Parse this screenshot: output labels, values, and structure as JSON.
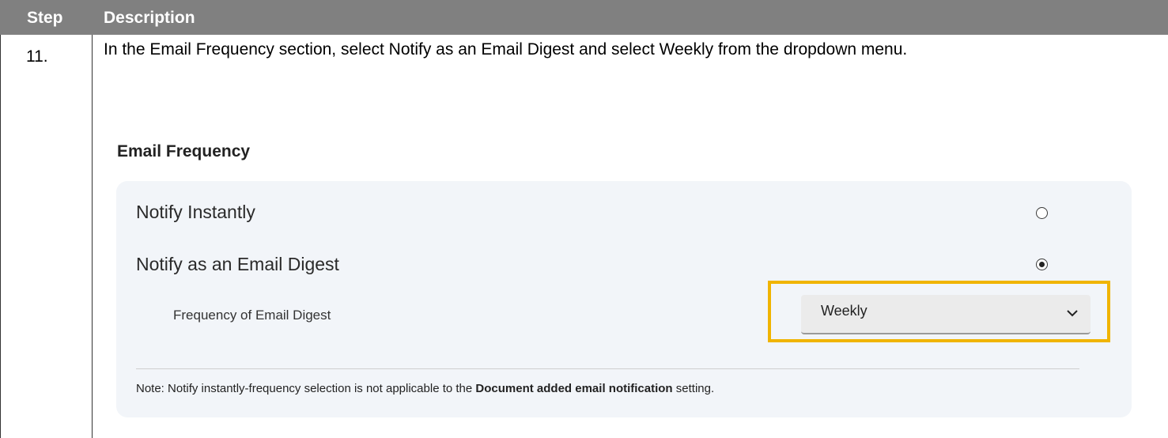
{
  "table": {
    "header_step": "Step",
    "header_description": "Description"
  },
  "step": {
    "number": "11.",
    "instruction": "In the Email Frequency section, select Notify as an Email Digest and select Weekly from the dropdown menu."
  },
  "email_frequency": {
    "title": "Email Frequency",
    "options": [
      {
        "label": "Notify Instantly",
        "selected": false
      },
      {
        "label": "Notify as an Email Digest",
        "selected": true
      }
    ],
    "digest_label": "Frequency of Email Digest",
    "digest_value": "Weekly",
    "note_prefix": "Note: Notify instantly-frequency selection is not applicable to the ",
    "note_bold": "Document added email notification",
    "note_suffix": " setting."
  },
  "colors": {
    "header_bg": "#808080",
    "panel_bg": "#f2f5f9",
    "highlight": "#f0b400"
  },
  "icons": {
    "radio_unselected": "radio-unselected-icon",
    "radio_selected": "radio-selected-icon",
    "dropdown": "chevron-down-icon"
  }
}
